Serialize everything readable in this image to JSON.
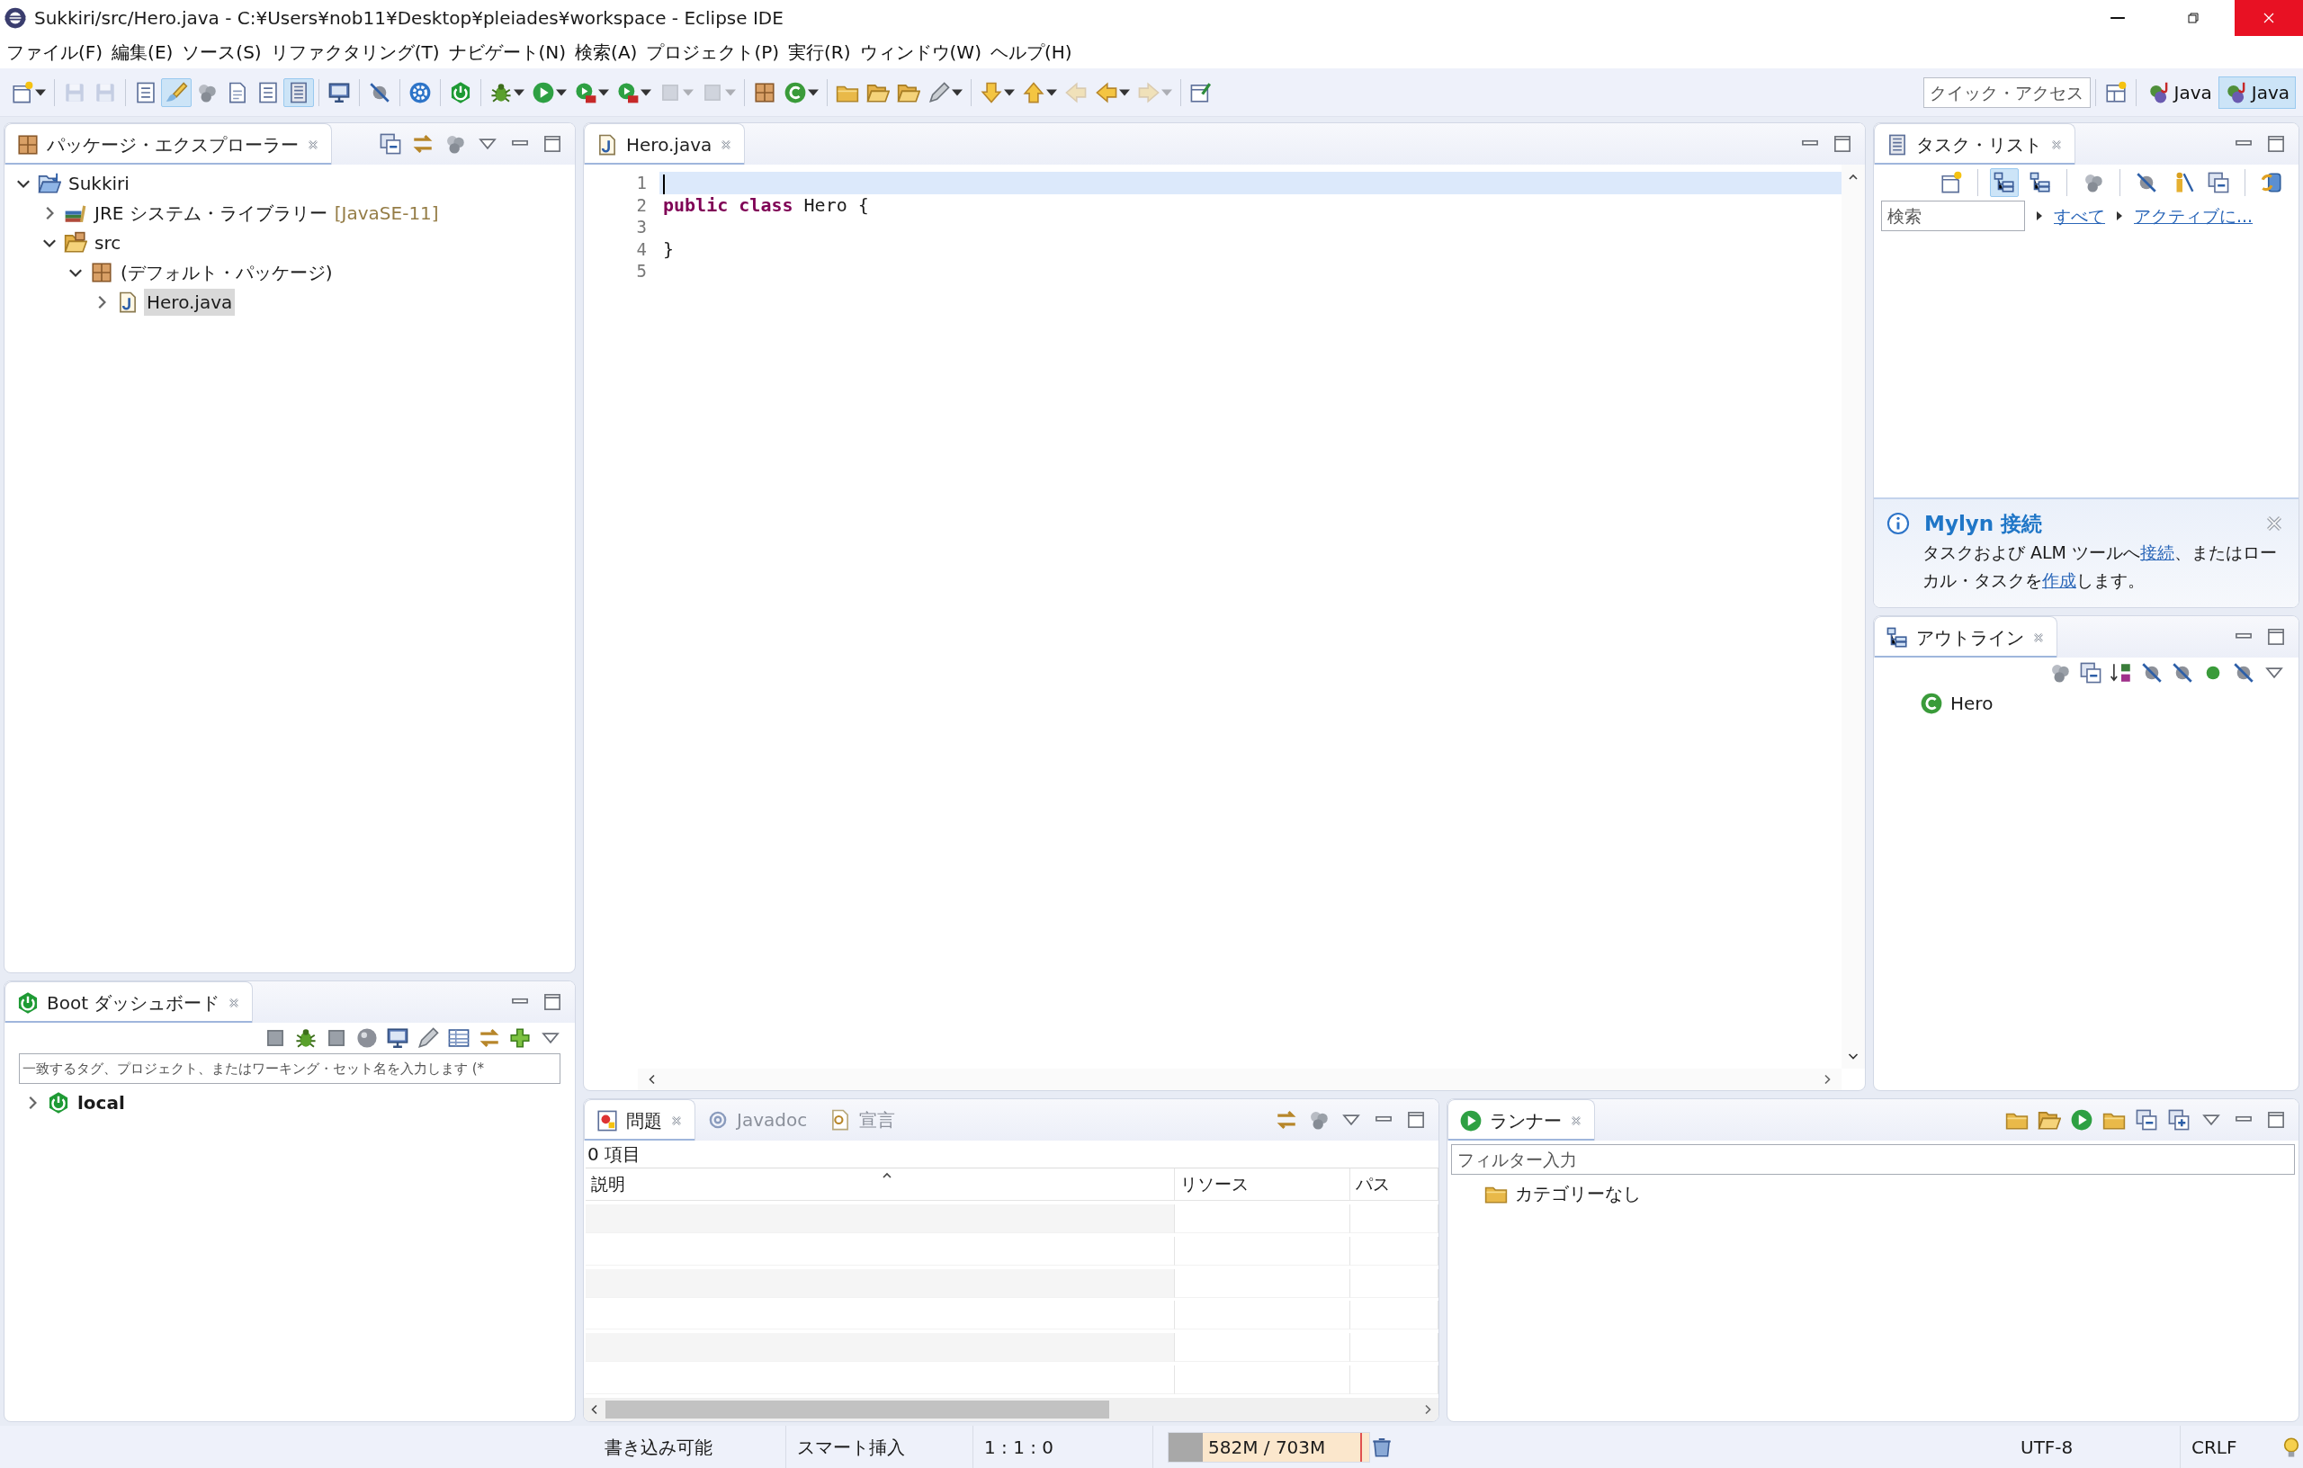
{
  "window": {
    "title": "Sukkiri/src/Hero.java - C:¥Users¥nob11¥Desktop¥pleiades¥workspace - Eclipse IDE"
  },
  "menu": [
    "ファイル(F)",
    "編集(E)",
    "ソース(S)",
    "リファクタリング(T)",
    "ナビゲート(N)",
    "検索(A)",
    "プロジェクト(P)",
    "実行(R)",
    "ウィンドウ(W)",
    "ヘルプ(H)"
  ],
  "toolbar": {
    "groups": [
      [
        {
          "pressed": false,
          "disabled": false,
          "dropdown": true
        }
      ],
      [
        {
          "pressed": false,
          "disabled": true,
          "dropdown": false
        },
        {
          "pressed": false,
          "disabled": true,
          "dropdown": false
        }
      ],
      [
        {
          "pressed": false,
          "disabled": false,
          "dropdown": false
        },
        {
          "pressed": true,
          "disabled": false,
          "dropdown": false
        },
        {
          "pressed": false,
          "disabled": false,
          "dropdown": false
        },
        {
          "pressed": false,
          "disabled": false,
          "dropdown": false
        },
        {
          "pressed": false,
          "disabled": false,
          "dropdown": false
        },
        {
          "pressed": true,
          "disabled": false,
          "dropdown": false
        }
      ],
      [
        {
          "pressed": false,
          "disabled": false,
          "dropdown": false
        }
      ],
      [
        {
          "pressed": false,
          "disabled": false,
          "dropdown": false
        }
      ],
      [
        {
          "pressed": false,
          "disabled": false,
          "dropdown": false
        }
      ],
      [
        {
          "pressed": false,
          "disabled": false,
          "dropdown": false
        }
      ],
      [
        {
          "pressed": false,
          "disabled": false,
          "dropdown": true
        },
        {
          "pressed": false,
          "disabled": false,
          "dropdown": true
        },
        {
          "pressed": false,
          "disabled": false,
          "dropdown": true
        },
        {
          "pressed": false,
          "disabled": false,
          "dropdown": true
        },
        {
          "pressed": false,
          "disabled": true,
          "dropdown": true
        },
        {
          "pressed": false,
          "disabled": true,
          "dropdown": true
        }
      ],
      [
        {
          "pressed": false,
          "disabled": false,
          "dropdown": false
        },
        {
          "pressed": false,
          "disabled": false,
          "dropdown": true
        }
      ],
      [
        {
          "pressed": false,
          "disabled": false,
          "dropdown": false
        },
        {
          "pressed": false,
          "disabled": false,
          "dropdown": false
        },
        {
          "pressed": false,
          "disabled": false,
          "dropdown": false
        },
        {
          "pressed": false,
          "disabled": false,
          "dropdown": true
        }
      ],
      [
        {
          "pressed": false,
          "disabled": false,
          "dropdown": true
        },
        {
          "pressed": false,
          "disabled": false,
          "dropdown": true
        },
        {
          "pressed": false,
          "disabled": true,
          "dropdown": false
        },
        {
          "pressed": false,
          "disabled": false,
          "dropdown": true
        },
        {
          "pressed": false,
          "disabled": true,
          "dropdown": true
        }
      ],
      [
        {
          "pressed": false,
          "disabled": false,
          "dropdown": false
        }
      ]
    ],
    "quick_access": {
      "placeholder": "クイック・アクセス"
    },
    "perspectives": [
      {
        "label": "Java",
        "selected": false
      },
      {
        "label": "Java",
        "selected": true
      }
    ]
  },
  "package_explorer": {
    "title": "パッケージ・エクスプローラー",
    "tree": [
      {
        "label": "Sukkiri",
        "kind": "project",
        "expanded": true,
        "selected": false,
        "children": [
          {
            "label": "JRE システム・ライブラリー",
            "decoration": "[JavaSE-11]",
            "kind": "library",
            "expanded": false,
            "selected": false
          },
          {
            "label": "src",
            "kind": "source",
            "expanded": true,
            "selected": false,
            "children": [
              {
                "label": "(デフォルト・パッケージ)",
                "kind": "package",
                "expanded": true,
                "selected": false,
                "children": [
                  {
                    "label": "Hero.java",
                    "kind": "java",
                    "expanded": false,
                    "selected": true
                  }
                ]
              }
            ]
          }
        ]
      }
    ]
  },
  "boot_dashboard": {
    "title": "Boot ダッシュボード",
    "filter": {
      "placeholder": "一致するタグ、プロジェクト、またはワーキング・セット名を入力します (*"
    },
    "tree": [
      {
        "label": "local",
        "kind": "boot",
        "expanded": false,
        "selected": false
      }
    ]
  },
  "editor": {
    "tabs": [
      {
        "label": "Hero.java",
        "selected": true
      }
    ],
    "lines": [
      {
        "number": "1",
        "current": true
      },
      {
        "number": "2",
        "text": "**public** **class** Hero {",
        "current": false
      },
      {
        "number": "3",
        "current": false
      },
      {
        "number": "4",
        "text": "}",
        "current": false
      },
      {
        "number": "5",
        "current": false
      }
    ]
  },
  "task_list": {
    "title": "タスク・リスト",
    "toolbar": [
      {
        "pressed": false
      },
      {
        "pressed": true
      },
      {
        "pressed": false
      },
      {
        "pressed": false
      },
      {
        "pressed": false
      },
      {
        "pressed": false
      },
      {
        "pressed": false
      },
      {
        "pressed": false
      }
    ],
    "search": {
      "placeholder": "検索"
    },
    "filters": [
      "すべて",
      "アクティブに..."
    ],
    "notice": {
      "title": "Mylyn 接続",
      "parts": [
        {
          "text": "タスクおよび ALM ツールへ",
          "link": false
        },
        {
          "text": "接続",
          "link": true
        },
        {
          "text": "、またはローカル・タスクを",
          "link": false
        },
        {
          "text": "作成",
          "link": true
        },
        {
          "text": "します。",
          "link": false
        }
      ]
    }
  },
  "outline": {
    "title": "アウトライン",
    "tree": [
      {
        "label": "Hero",
        "kind": "class",
        "selected": false
      }
    ]
  },
  "problems": {
    "tabs": [
      {
        "label": "問題",
        "selected": true
      },
      {
        "label": "Javadoc",
        "selected": false
      },
      {
        "label": "宣言",
        "selected": false
      }
    ],
    "summary": "0 項目",
    "columns": [
      {
        "label": "説明",
        "sorted": true
      },
      {
        "label": "リソース",
        "sorted": false
      },
      {
        "label": "パス",
        "sorted": false
      }
    ]
  },
  "runner": {
    "title": "ランナー",
    "filter": {
      "placeholder": "フィルター入力"
    },
    "tree": [
      {
        "label": "カテゴリーなし",
        "kind": "folder",
        "selected": false
      }
    ]
  },
  "status_bar": {
    "mode": "書き込み可能",
    "insert": "スマート挿入",
    "position": "1 : 1 : 0",
    "heap": {
      "text": "582M / 703M",
      "level": 0.17
    },
    "encoding": "UTF-8",
    "line_ending": "CRLF"
  }
}
